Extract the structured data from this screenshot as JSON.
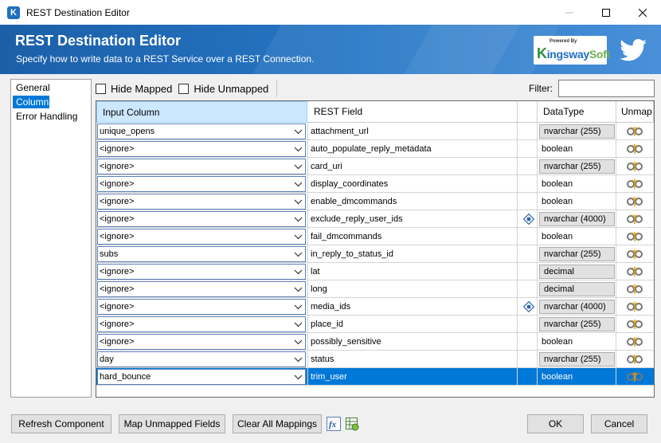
{
  "window": {
    "title": "REST Destination Editor",
    "app_icon": "K"
  },
  "banner": {
    "title": "REST Destination Editor",
    "subtitle": "Specify how to write data to a REST Service over a REST Connection.",
    "brand_powered": "Powered By",
    "brand_k": "K",
    "brand_ingsway": "ingsway",
    "brand_soft": "Soft",
    "brand_icon": "twitter-bird-icon"
  },
  "nav": {
    "items": [
      "General",
      "Columns",
      "Error Handling"
    ],
    "selected": "Columns"
  },
  "toolbar": {
    "hide_mapped": "Hide Mapped",
    "hide_unmapped": "Hide Unmapped",
    "filter_label": "Filter:",
    "filter_value": ""
  },
  "grid": {
    "headers": {
      "input": "Input Column",
      "field": "REST Field",
      "datatype": "DataType",
      "unmap": "Unmap"
    },
    "rows": [
      {
        "input": "unique_opens",
        "field": "attachment_url",
        "datatype": "nvarchar (255)",
        "dt_button": true,
        "has_diamond": false
      },
      {
        "input": "<ignore>",
        "field": "auto_populate_reply_metadata",
        "datatype": "boolean",
        "dt_button": false,
        "has_diamond": false
      },
      {
        "input": "<ignore>",
        "field": "card_uri",
        "datatype": "nvarchar (255)",
        "dt_button": true,
        "has_diamond": false
      },
      {
        "input": "<ignore>",
        "field": "display_coordinates",
        "datatype": "boolean",
        "dt_button": false,
        "has_diamond": false
      },
      {
        "input": "<ignore>",
        "field": "enable_dmcommands",
        "datatype": "boolean",
        "dt_button": false,
        "has_diamond": false
      },
      {
        "input": "<ignore>",
        "field": "exclude_reply_user_ids",
        "datatype": "nvarchar (4000)",
        "dt_button": true,
        "has_diamond": true
      },
      {
        "input": "<ignore>",
        "field": "fail_dmcommands",
        "datatype": "boolean",
        "dt_button": false,
        "has_diamond": false
      },
      {
        "input": "subs",
        "field": "in_reply_to_status_id",
        "datatype": "nvarchar (255)",
        "dt_button": true,
        "has_diamond": false
      },
      {
        "input": "<ignore>",
        "field": "lat",
        "datatype": "decimal",
        "dt_button": true,
        "has_diamond": false
      },
      {
        "input": "<ignore>",
        "field": "long",
        "datatype": "decimal",
        "dt_button": true,
        "has_diamond": false
      },
      {
        "input": "<ignore>",
        "field": "media_ids",
        "datatype": "nvarchar (4000)",
        "dt_button": true,
        "has_diamond": true
      },
      {
        "input": "<ignore>",
        "field": "place_id",
        "datatype": "nvarchar (255)",
        "dt_button": true,
        "has_diamond": false
      },
      {
        "input": "<ignore>",
        "field": "possibly_sensitive",
        "datatype": "boolean",
        "dt_button": false,
        "has_diamond": false
      },
      {
        "input": "day",
        "field": "status",
        "datatype": "nvarchar (255)",
        "dt_button": true,
        "has_diamond": false
      },
      {
        "input": "hard_bounce",
        "field": "trim_user",
        "datatype": "boolean",
        "dt_button": false,
        "has_diamond": false,
        "selected": true
      }
    ]
  },
  "buttons": {
    "refresh": "Refresh Component",
    "map_unmapped": "Map Unmapped Fields",
    "clear_all": "Clear All Mappings",
    "expression_icon": "fx-icon",
    "grid_icon": "grid-settings-icon",
    "ok": "OK",
    "cancel": "Cancel"
  },
  "colors": {
    "accent": "#0078d7",
    "banner": "#2677c6"
  }
}
